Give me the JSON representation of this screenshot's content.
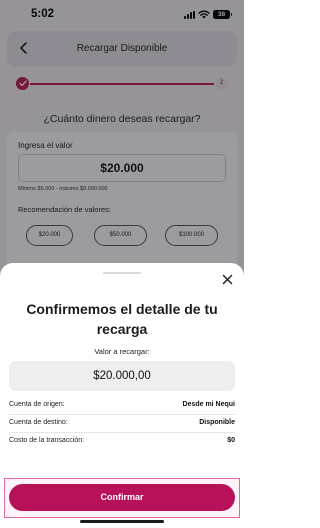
{
  "status_bar": {
    "time": "5:02",
    "battery": "38"
  },
  "header": {
    "title": "Recargar Disponible"
  },
  "progress": {
    "current_step": 1,
    "next_step_label": "2",
    "fraction_complete": 0.0
  },
  "question": "¿Cuánto dinero deseas recargar?",
  "amount_card": {
    "field_label": "Ingresa el valor",
    "value": "$20.000",
    "limits": "Mínimo $5.000 - máximo $8.000.000",
    "recommendation_label": "Recomendación de valores:",
    "options": [
      "$20.000",
      "$50.000",
      "$100.000"
    ]
  },
  "sheet": {
    "title": "Confirmemos el detalle de tu recarga",
    "value_label": "Valor a recargar:",
    "value": "$20.000,00",
    "rows": [
      {
        "label": "Cuenta de origen:",
        "value": "Desde mi Nequi"
      },
      {
        "label": "Cuenta de destino:",
        "value": "Disponible"
      },
      {
        "label": "Costo de la transacción:",
        "value": "$0"
      }
    ],
    "confirm_label": "Confirmar"
  },
  "colors": {
    "accent": "#b7115a",
    "step_done": "#c01a57",
    "overlay": "rgba(20,16,24,0.42)"
  },
  "icons": [
    "back-arrow-icon",
    "check-icon",
    "close-icon",
    "wifi-icon",
    "signal-icon",
    "battery-icon"
  ]
}
